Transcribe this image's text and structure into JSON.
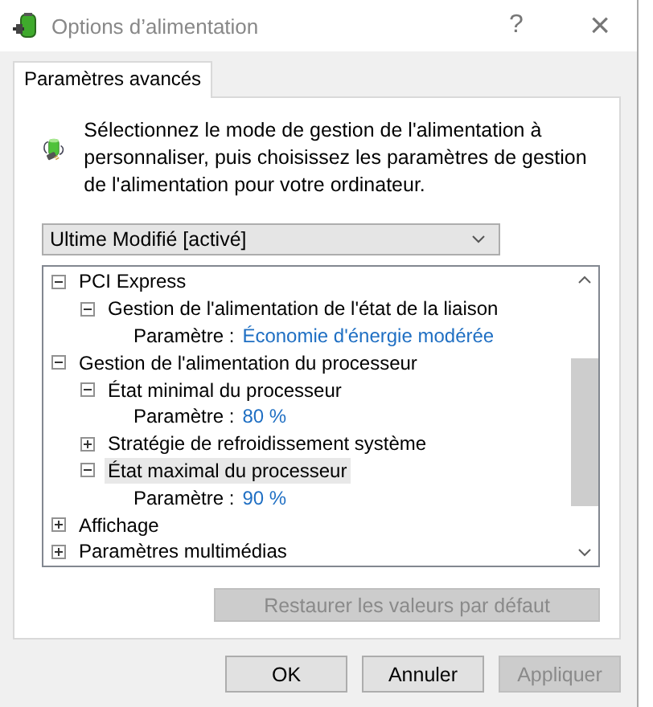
{
  "window": {
    "title": "Options d’alimentation",
    "help": "?",
    "close": "×"
  },
  "tabs": [
    {
      "label": "Paramètres avancés",
      "selected": true
    }
  ],
  "intro": "Sélectionnez le mode de gestion de l'alimentation à personnaliser, puis choisissez les paramètres de gestion de l'alimentation pour votre ordinateur.",
  "plan_dropdown": {
    "value": "Ultime Modifié [activé]"
  },
  "tree": [
    {
      "kind": "group",
      "label": "PCI Express",
      "expanded": true,
      "selected": false,
      "children": [
        {
          "kind": "group",
          "label": "Gestion de l'alimentation de l'état de la liaison",
          "expanded": true,
          "selected": false,
          "children": [
            {
              "kind": "setting",
              "label": "Paramètre :",
              "value": "Économie d'énergie modérée",
              "selected": false
            }
          ]
        }
      ]
    },
    {
      "kind": "group",
      "label": "Gestion de l'alimentation du processeur",
      "expanded": true,
      "selected": false,
      "children": [
        {
          "kind": "group",
          "label": "État minimal du processeur",
          "expanded": true,
          "selected": false,
          "children": [
            {
              "kind": "setting",
              "label": "Paramètre :",
              "value": "80  %",
              "selected": false
            }
          ]
        },
        {
          "kind": "group",
          "label": "Stratégie de refroidissement système",
          "expanded": false,
          "selected": false
        },
        {
          "kind": "group",
          "label": "État maximal du processeur",
          "expanded": true,
          "selected": true,
          "children": [
            {
              "kind": "setting",
              "label": "Paramètre :",
              "value": "90  %",
              "selected": false
            }
          ]
        }
      ]
    },
    {
      "kind": "group",
      "label": "Affichage",
      "expanded": false,
      "selected": false
    },
    {
      "kind": "group",
      "label": "Paramètres multimédias",
      "expanded": false,
      "selected": false
    }
  ],
  "restore_button": {
    "label": "Restaurer les valeurs par défaut",
    "disabled": true
  },
  "buttons": [
    {
      "label": "OK",
      "disabled": false
    },
    {
      "label": "Annuler",
      "disabled": false
    },
    {
      "label": "Appliquer",
      "disabled": true
    }
  ]
}
